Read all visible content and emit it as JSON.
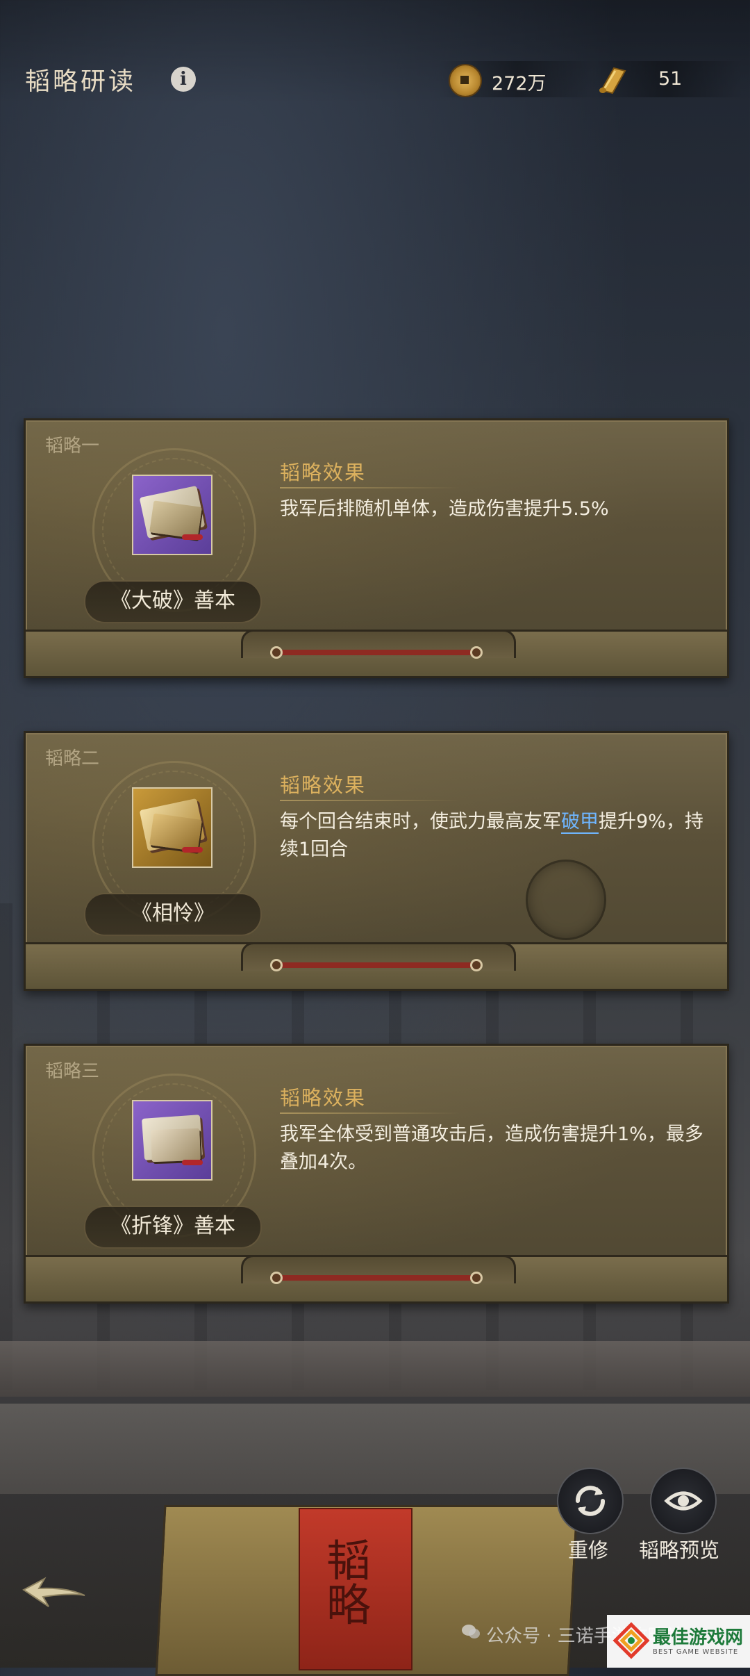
{
  "header": {
    "title": "韬略研读",
    "info_icon": "info-icon",
    "copper_coins": "272万",
    "scrolls": "51"
  },
  "cards": [
    {
      "label": "韬略一",
      "item_name": "《大破》善本",
      "effect_title": "韬略效果",
      "effect_text": "我军后排随机单体，造成伤害提升5.5%",
      "item_color": "purple"
    },
    {
      "label": "韬略二",
      "item_name": "《相怜》",
      "effect_title": "韬略效果",
      "effect_text_before": "每个回合结束时，使武力最高友军",
      "effect_highlight": "破甲",
      "effect_text_after": "提升9%，持续1回合",
      "item_color": "gold"
    },
    {
      "label": "韬略三",
      "item_name": "《折锋》善本",
      "effect_title": "韬略效果",
      "effect_text": "我军全体受到普通攻击后，造成伤害提升1%，最多叠加4次。",
      "item_color": "purple"
    }
  ],
  "actions": {
    "reset_label": "重修",
    "preview_label": "韬略预览"
  },
  "box_label": "韬略",
  "watermark": "公众号 · 三诺手游攻略社",
  "site_logo": {
    "name": "最佳游戏网",
    "tagline": "BEST GAME WEBSITE"
  },
  "colors": {
    "accent_gold": "#dcb15e",
    "highlight_blue": "#6fb6ff",
    "card_bg": "#5b5139"
  }
}
